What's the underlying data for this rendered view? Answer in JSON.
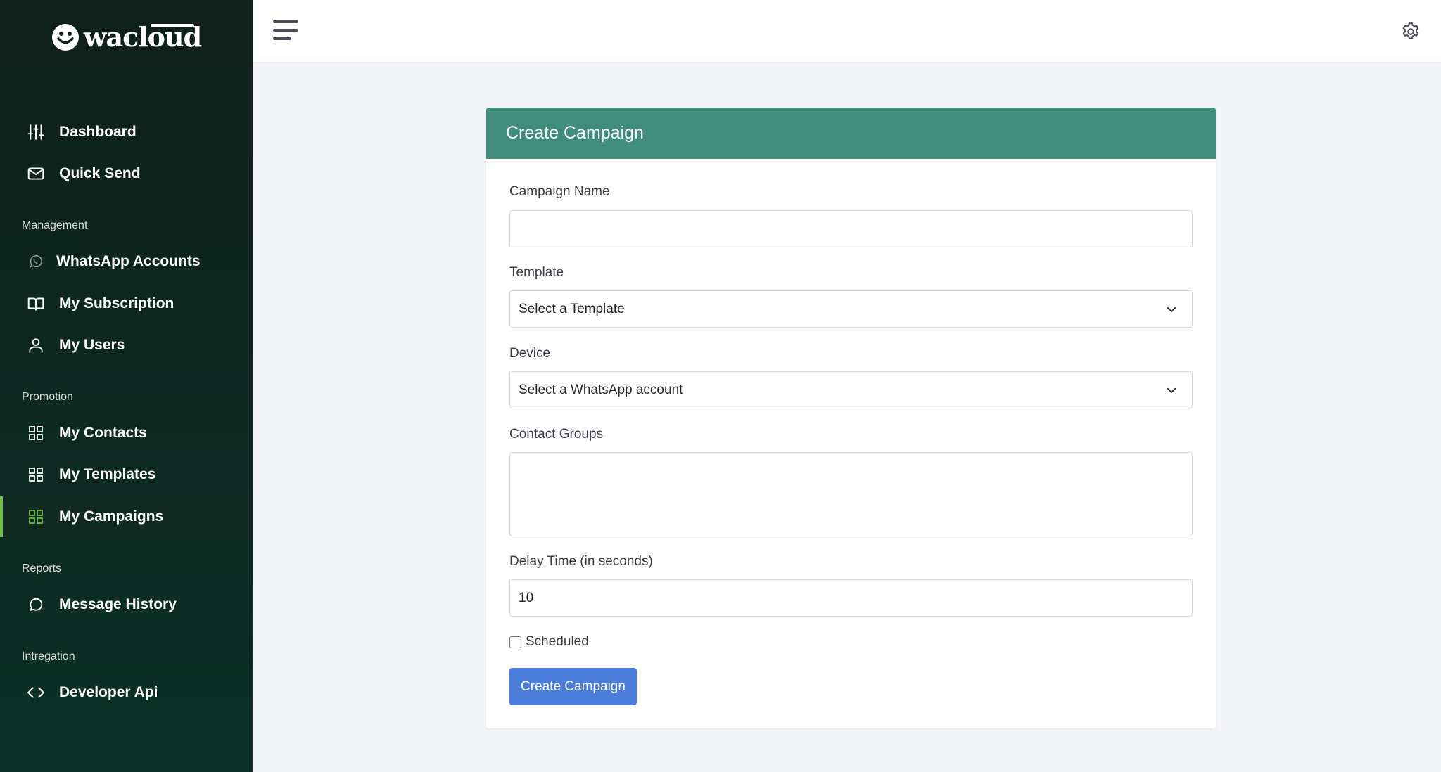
{
  "brand": {
    "name": "wacloud"
  },
  "sidebar": {
    "top_items": [
      {
        "label": "Dashboard",
        "icon": "sliders-icon"
      },
      {
        "label": "Quick Send",
        "icon": "envelope-icon"
      }
    ],
    "sections": [
      {
        "label": "Management",
        "items": [
          {
            "label": "WhatsApp Accounts",
            "icon": "whatsapp-icon"
          },
          {
            "label": "My Subscription",
            "icon": "book-icon"
          },
          {
            "label": "My Users",
            "icon": "user-icon"
          }
        ]
      },
      {
        "label": "Promotion",
        "items": [
          {
            "label": "My Contacts",
            "icon": "grid-icon"
          },
          {
            "label": "My Templates",
            "icon": "grid-icon"
          },
          {
            "label": "My Campaigns",
            "icon": "grid-icon",
            "active": true
          }
        ]
      },
      {
        "label": "Reports",
        "items": [
          {
            "label": "Message History",
            "icon": "chat-bubble-icon"
          }
        ]
      },
      {
        "label": "Intregation",
        "items": [
          {
            "label": "Developer Api",
            "icon": "code-icon"
          }
        ]
      }
    ],
    "active_accent": "#6fbf44"
  },
  "topbar": {
    "menu_icon": "hamburger-icon",
    "settings_icon": "gear-icon"
  },
  "form": {
    "title": "Create Campaign",
    "header_color": "#418d7c",
    "campaign_name": {
      "label": "Campaign Name",
      "value": ""
    },
    "template": {
      "label": "Template",
      "selected": "Select a Template"
    },
    "device": {
      "label": "Device",
      "selected": "Select a WhatsApp account"
    },
    "contact_groups": {
      "label": "Contact Groups"
    },
    "delay": {
      "label": "Delay Time (in seconds)",
      "value": "10"
    },
    "scheduled": {
      "label": "Scheduled",
      "checked": false
    },
    "submit_label": "Create Campaign",
    "submit_color": "#4a7ddc"
  }
}
